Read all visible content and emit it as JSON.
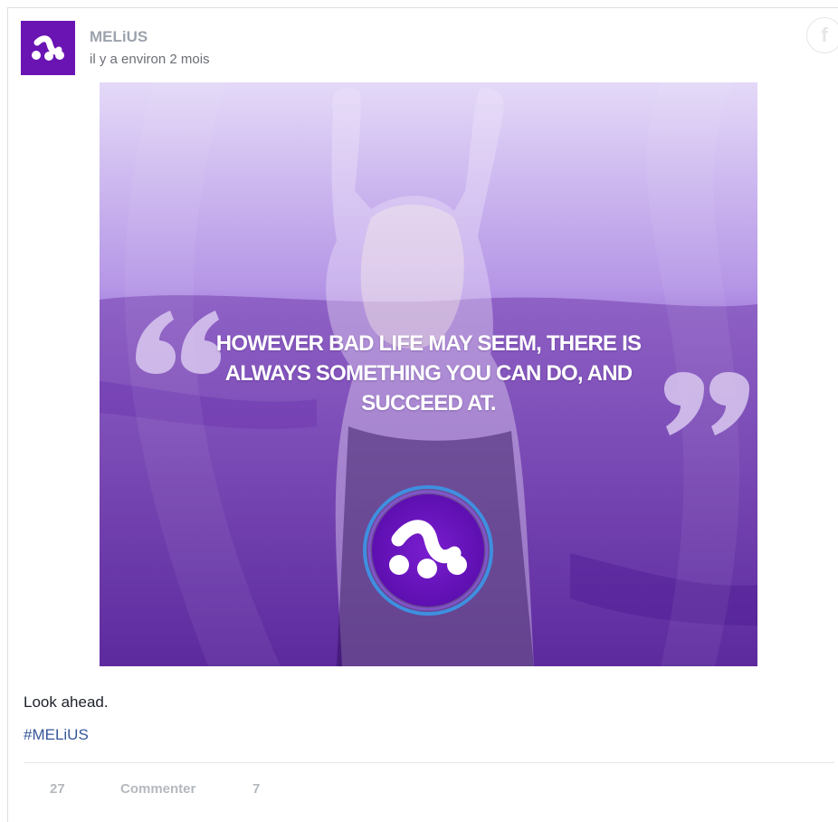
{
  "post": {
    "author": "MELiUS",
    "timestamp": "il y a environ 2 mois",
    "network_icon": "facebook-icon",
    "image": {
      "quote_lines": [
        "HOWEVER BAD LIFE MAY SEEM, THERE IS",
        "ALWAYS SOMETHING YOU CAN DO, AND",
        "SUCCEED AT."
      ],
      "colors": {
        "overlay": "#7b3fc4",
        "brand": "#6a14b3",
        "ring": "#3f8fe0"
      }
    },
    "caption": "Look ahead.",
    "hashtag": "#MELiUS",
    "actions": {
      "likes": "27",
      "comment_label": "Commenter",
      "shares": "7"
    }
  }
}
